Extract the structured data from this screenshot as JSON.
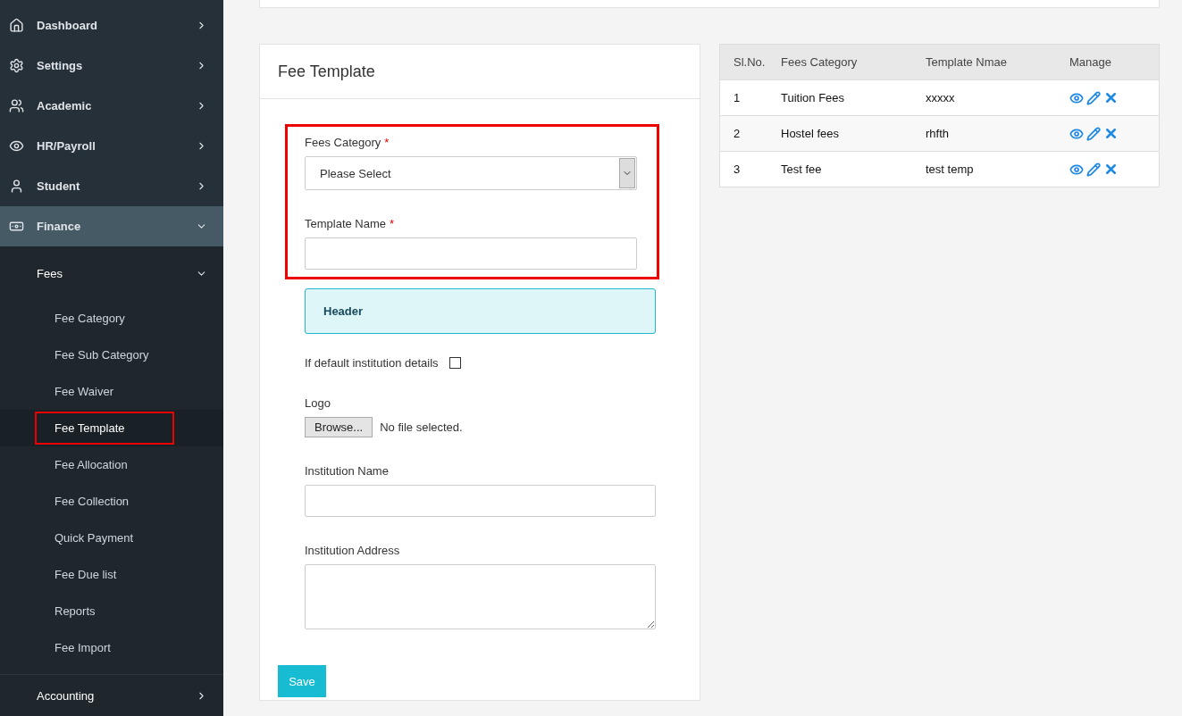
{
  "sidebar": {
    "items": [
      {
        "label": "Dashboard",
        "expanded": false,
        "selected": false
      },
      {
        "label": "Settings",
        "expanded": false,
        "selected": false
      },
      {
        "label": "Academic",
        "expanded": false,
        "selected": false
      },
      {
        "label": "HR/Payroll",
        "expanded": false,
        "selected": false
      },
      {
        "label": "Student",
        "expanded": false,
        "selected": false
      },
      {
        "label": "Finance",
        "expanded": true,
        "selected": true,
        "children": [
          {
            "label": "Fees",
            "expanded": true,
            "selected": false,
            "children": [
              {
                "label": "Fee Category",
                "selected": false,
                "highlighted": false
              },
              {
                "label": "Fee Sub Category",
                "selected": false,
                "highlighted": false
              },
              {
                "label": "Fee Waiver",
                "selected": false,
                "highlighted": false
              },
              {
                "label": "Fee Template",
                "selected": true,
                "highlighted": true
              },
              {
                "label": "Fee Allocation",
                "selected": false,
                "highlighted": false
              },
              {
                "label": "Fee Collection",
                "selected": false,
                "highlighted": false
              },
              {
                "label": "Quick Payment",
                "selected": false,
                "highlighted": false
              },
              {
                "label": "Fee Due list",
                "selected": false,
                "highlighted": false
              },
              {
                "label": "Reports",
                "selected": false,
                "highlighted": false
              },
              {
                "label": "Fee Import",
                "selected": false,
                "highlighted": false
              }
            ]
          },
          {
            "label": "Accounting",
            "expanded": false,
            "selected": false
          }
        ]
      }
    ]
  },
  "form": {
    "title": "Fee Template",
    "fields": [
      {
        "kind": "select",
        "label": "Fees Category",
        "required_mark": "*",
        "value": "Please Select",
        "highlighted": true
      },
      {
        "kind": "text",
        "label": "Template Name",
        "required_mark": "*",
        "highlighted": true
      },
      {
        "kind": "header",
        "label": "Header",
        "highlighted": false
      },
      {
        "kind": "checkbox",
        "label": "If default institution details",
        "checked": false,
        "highlighted": false
      },
      {
        "kind": "file",
        "label": "Logo",
        "button": "Browse...",
        "status": "No file selected.",
        "highlighted": false
      },
      {
        "kind": "text",
        "label": "Institution Name",
        "highlighted": false
      },
      {
        "kind": "textarea",
        "label": "Institution Address",
        "highlighted": false
      }
    ],
    "save": "Save"
  },
  "table": {
    "columns": [
      "Sl.No.",
      "Fees Category",
      "Template Nmae",
      "Manage"
    ],
    "rows": [
      {
        "cells": [
          "1",
          "Tuition Fees",
          "xxxxx"
        ]
      },
      {
        "cells": [
          "2",
          "Hostel fees",
          "rhfth"
        ]
      },
      {
        "cells": [
          "3",
          "Test fee",
          "test temp"
        ]
      }
    ]
  }
}
